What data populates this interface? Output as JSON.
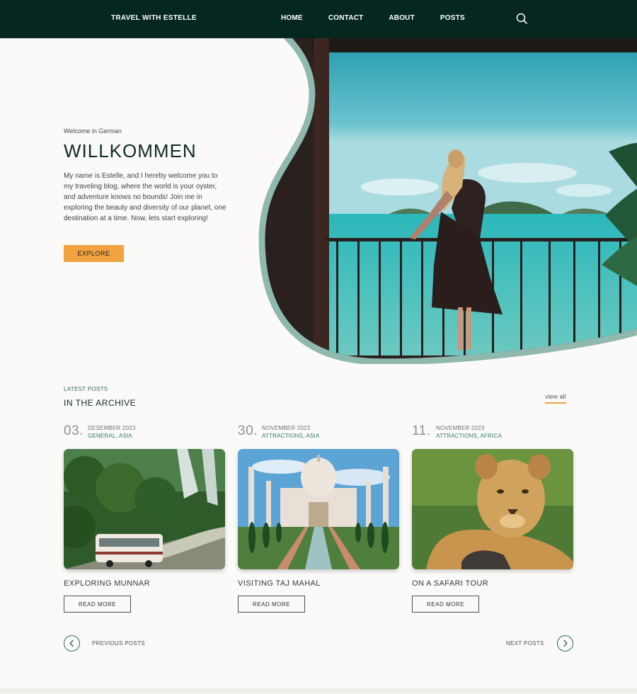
{
  "header": {
    "brand": "TRAVEL WITH ESTELLE",
    "nav": [
      "HOME",
      "CONTACT",
      "ABOUT",
      "POSTS"
    ],
    "search_icon": "search-icon"
  },
  "hero": {
    "eyebrow": "Welcome in German",
    "title": "WILLKOMMEN",
    "body": "My name is Estelle, and I hereby welcome you to my traveling blog, where the world is your oyster, and adventure knows no bounds! Join me in exploring the beauty and diversity of our planet, one destination at a time. Now, lets start exploring!",
    "button": "EXPLORE",
    "image": "woman-on-balcony-overlooking-sea"
  },
  "archive": {
    "eyebrow": "LATEST POSTS",
    "title": "IN THE ARCHIVE",
    "view_all": "view all",
    "posts": [
      {
        "day": "03.",
        "month": "DESEMBER 2023",
        "categories": "GENERAL, ASIA",
        "title": "EXPLORING MUNNAR",
        "button": "READ MORE",
        "image": "bus-in-jungle"
      },
      {
        "day": "30.",
        "month": "NOVEMBER 2023",
        "categories": "ATTRACTIONS, ASIA",
        "title": "VISITING TAJ MAHAL",
        "button": "READ MORE",
        "image": "taj-mahal"
      },
      {
        "day": "11.",
        "month": "NOVEMBER 2023",
        "categories": "ATTRACTIONS, AFRICA",
        "title": "ON A SAFARI TOUR",
        "button": "READ MORE",
        "image": "lion-cub"
      }
    ]
  },
  "pagination": {
    "previous": "PREVIOUS POSTS",
    "next": "NEXT POSTS"
  },
  "colors": {
    "header_bg": "#062620",
    "accent": "#f0a340",
    "teal": "#2f6a63",
    "page_bg": "#fbfaf8"
  }
}
